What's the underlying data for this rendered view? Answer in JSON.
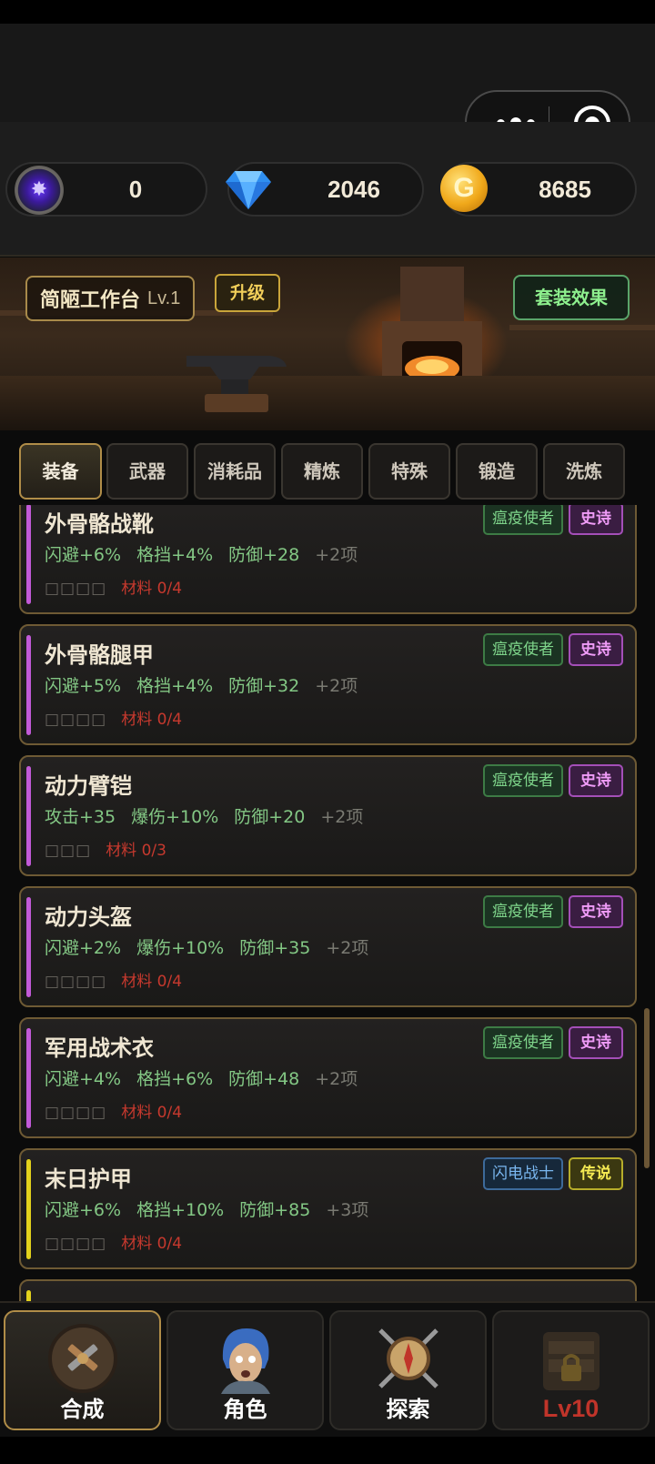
{
  "currencies": [
    {
      "icon": "purple-orb-icon",
      "value": "0"
    },
    {
      "icon": "diamond-icon",
      "value": "2046"
    },
    {
      "icon": "gold-coin-icon",
      "value": "8685"
    }
  ],
  "workbench": {
    "name": "简陋工作台",
    "level": "Lv.1",
    "upgrade_label": "升级",
    "set_effect_label": "套装效果",
    "coin_glyph": "G"
  },
  "tabs": [
    "装备",
    "武器",
    "消耗品",
    "精炼",
    "特殊",
    "锻造",
    "洗炼"
  ],
  "active_tab": "装备",
  "items": [
    {
      "name": "外骨骼战靴",
      "stats": [
        "闪避+6%",
        "格挡+4%",
        "防御+28"
      ],
      "more": "+2项",
      "boxes": "□□□□",
      "materials": "材料 0/4",
      "class": "瘟疫使者",
      "rarity": "史诗"
    },
    {
      "name": "外骨骼腿甲",
      "stats": [
        "闪避+5%",
        "格挡+4%",
        "防御+32"
      ],
      "more": "+2项",
      "boxes": "□□□□",
      "materials": "材料 0/4",
      "class": "瘟疫使者",
      "rarity": "史诗"
    },
    {
      "name": "动力臂铠",
      "stats": [
        "攻击+35",
        "爆伤+10%",
        "防御+20"
      ],
      "more": "+2项",
      "boxes": "□□□",
      "materials": "材料 0/3",
      "class": "瘟疫使者",
      "rarity": "史诗"
    },
    {
      "name": "动力头盔",
      "stats": [
        "闪避+2%",
        "爆伤+10%",
        "防御+35"
      ],
      "more": "+2项",
      "boxes": "□□□□",
      "materials": "材料 0/4",
      "class": "瘟疫使者",
      "rarity": "史诗"
    },
    {
      "name": "军用战术衣",
      "stats": [
        "闪避+4%",
        "格挡+6%",
        "防御+48"
      ],
      "more": "+2项",
      "boxes": "□□□□",
      "materials": "材料 0/4",
      "class": "瘟疫使者",
      "rarity": "史诗"
    },
    {
      "name": "末日护甲",
      "stats": [
        "闪避+6%",
        "格挡+10%",
        "防御+85"
      ],
      "more": "+3项",
      "boxes": "□□□□",
      "materials": "材料 0/4",
      "class": "闪电战士",
      "rarity": "传说"
    }
  ],
  "colors": {
    "epic": "#c25ad8",
    "legendary": "#e3d21c",
    "stat_green": "#83c784",
    "material_red": "#c7392e",
    "gold_border": "#b08d48"
  },
  "bottom_nav": [
    {
      "label": "合成",
      "icon": "crafting-tools-icon",
      "active": true
    },
    {
      "label": "角色",
      "icon": "character-portrait-icon",
      "active": false
    },
    {
      "label": "探索",
      "icon": "compass-swords-icon",
      "active": false
    },
    {
      "label": "Lv10",
      "icon": "locked-shop-icon",
      "active": false,
      "locked": true
    }
  ]
}
